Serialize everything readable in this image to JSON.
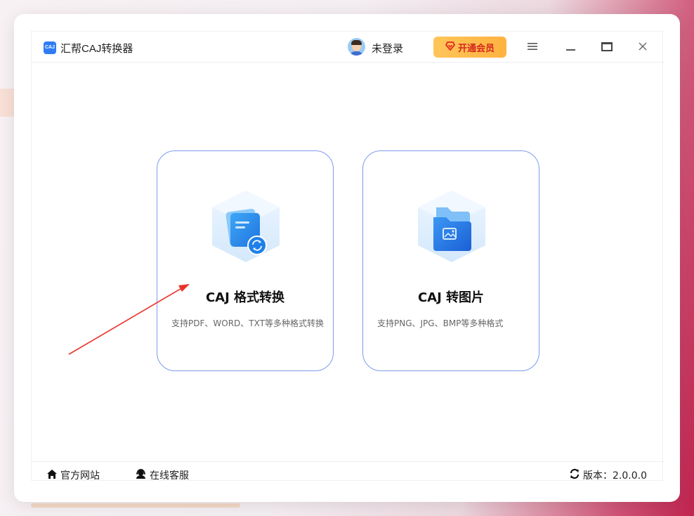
{
  "app": {
    "logo_text": "CAJ",
    "title": "汇帮CAJ转换器"
  },
  "header": {
    "user_status": "未登录",
    "vip_label": "开通会员",
    "menu_icon": "menu-icon",
    "minimize_icon": "minimize-icon",
    "maximize_icon": "maximize-icon",
    "close_icon": "close-icon"
  },
  "cards": [
    {
      "title": "CAJ 格式转换",
      "description": "支持PDF、WORD、TXT等多种格式转换",
      "icon": "document-convert-icon"
    },
    {
      "title": "CAJ 转图片",
      "description": "支持PNG、JPG、BMP等多种格式",
      "icon": "image-folder-icon"
    }
  ],
  "footer": {
    "website_label": "官方网站",
    "service_label": "在线客服",
    "version_label": "版本：2.0.0.0"
  },
  "colors": {
    "accent": "#2f7cf6",
    "vip_bg": "#ffbf4f",
    "vip_text": "#d2281f",
    "card_border": "#7c9bf0",
    "arrow": "#e8332a"
  }
}
